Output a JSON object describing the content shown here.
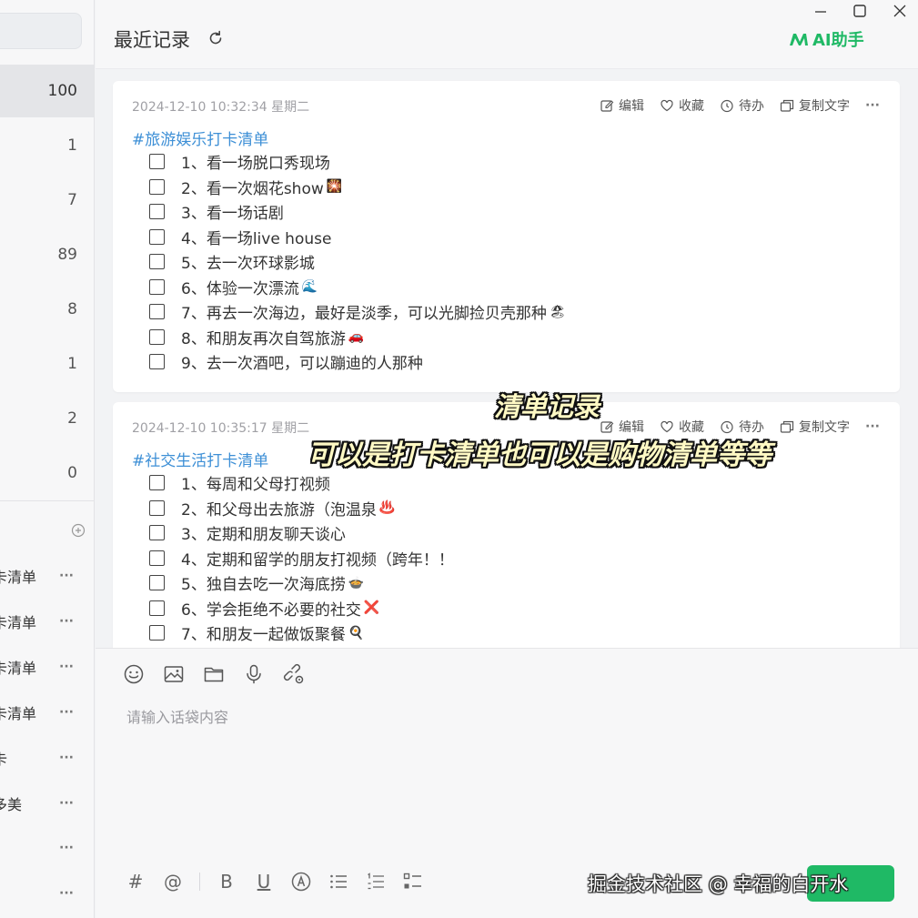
{
  "sidebar": {
    "counts": [
      "100",
      "1",
      "7",
      "89",
      "8",
      "1",
      "2",
      "0"
    ],
    "tags": [
      {
        "label": "卡清单",
        "more": "···"
      },
      {
        "label": "卡清单",
        "more": "···"
      },
      {
        "label": "卡清单",
        "more": "···"
      },
      {
        "label": "卡清单",
        "more": "···"
      },
      {
        "label": "卡",
        "more": "···"
      },
      {
        "label": "多美",
        "more": "···"
      },
      {
        "label": "",
        "more": "···"
      },
      {
        "label": "",
        "more": "···"
      }
    ]
  },
  "header": {
    "title": "最近记录",
    "ai_label": "AI助手"
  },
  "card_actions": {
    "edit": "编辑",
    "favorite": "收藏",
    "todo": "待办",
    "copy": "复制文字",
    "more": "···"
  },
  "notes": [
    {
      "meta": "2024-12-10 10:32:34 星期二",
      "tag": "#旅游娱乐打卡清单",
      "items": [
        {
          "text": "1、看一场脱口秀现场",
          "emoji": ""
        },
        {
          "text": "2、看一次烟花show",
          "emoji": "🎇"
        },
        {
          "text": "3、看一场话剧",
          "emoji": ""
        },
        {
          "text": "4、看一场live house",
          "emoji": ""
        },
        {
          "text": "5、去一次环球影城",
          "emoji": ""
        },
        {
          "text": "6、体验一次漂流",
          "emoji": "🌊"
        },
        {
          "text": "7、再去一次海边，最好是淡季，可以光脚捡贝壳那种",
          "emoji": "🏖"
        },
        {
          "text": "8、和朋友再次自驾旅游",
          "emoji": "🚗"
        },
        {
          "text": "9、去一次酒吧，可以蹦迪的人那种",
          "emoji": ""
        }
      ]
    },
    {
      "meta": "2024-12-10 10:35:17 星期二",
      "tag": "#社交生活打卡清单",
      "items": [
        {
          "text": "1、每周和父母打视频",
          "emoji": ""
        },
        {
          "text": "2、和父母出去旅游（泡温泉",
          "emoji": "♨️"
        },
        {
          "text": "3、定期和朋友聊天谈心",
          "emoji": ""
        },
        {
          "text": "4、定期和留学的朋友打视频（跨年！！",
          "emoji": ""
        },
        {
          "text": "5、独自去吃一次海底捞",
          "emoji": "🍲"
        },
        {
          "text": "6、学会拒绝不必要的社交",
          "emoji": "❌"
        },
        {
          "text": "7、和朋友一起做饭聚餐",
          "emoji": "🍳"
        }
      ]
    }
  ],
  "overlay": {
    "caption_line1": "清单记录",
    "caption_line2": "可以是打卡清单也可以是购物清单等等"
  },
  "editor": {
    "placeholder": "请输入话袋内容",
    "watermark": "掘金技术社区 @ 幸福的白开水"
  },
  "colors": {
    "accent_green": "#1fb965",
    "tag_blue": "#3d8fd6"
  }
}
